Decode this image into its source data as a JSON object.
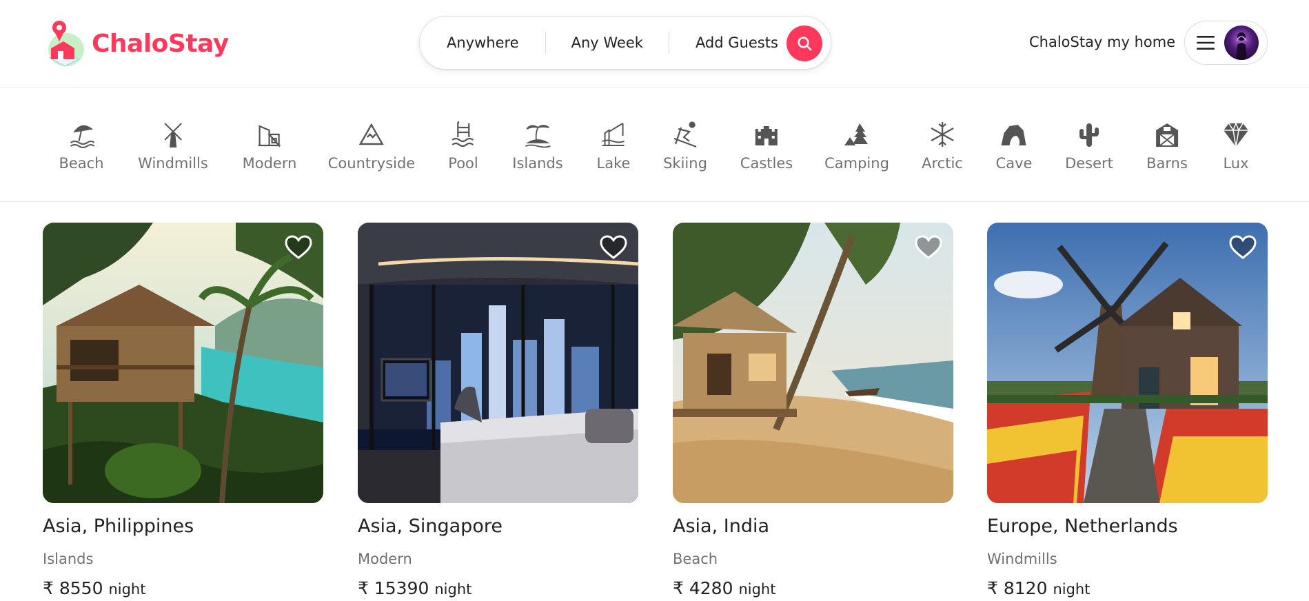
{
  "brand": {
    "name": "ChaloStay",
    "accent": "#ff385c"
  },
  "search": {
    "where": "Anywhere",
    "when": "Any Week",
    "guests": "Add Guests"
  },
  "header": {
    "host_link": "ChaloStay my home"
  },
  "categories": [
    {
      "label": "Beach",
      "icon": "beach-umbrella-icon"
    },
    {
      "label": "Windmills",
      "icon": "windmill-icon"
    },
    {
      "label": "Modern",
      "icon": "modern-building-icon"
    },
    {
      "label": "Countryside",
      "icon": "mountain-icon"
    },
    {
      "label": "Pool",
      "icon": "pool-ladder-icon"
    },
    {
      "label": "Islands",
      "icon": "palm-island-icon"
    },
    {
      "label": "Lake",
      "icon": "fishing-lake-icon"
    },
    {
      "label": "Skiing",
      "icon": "skier-icon"
    },
    {
      "label": "Castles",
      "icon": "castle-icon"
    },
    {
      "label": "Camping",
      "icon": "tent-icon"
    },
    {
      "label": "Arctic",
      "icon": "snowflake-icon"
    },
    {
      "label": "Cave",
      "icon": "cave-icon"
    },
    {
      "label": "Desert",
      "icon": "cactus-icon"
    },
    {
      "label": "Barns",
      "icon": "barn-icon"
    },
    {
      "label": "Lux",
      "icon": "diamond-icon"
    }
  ],
  "listings": [
    {
      "location": "Asia, Philippines",
      "category": "Islands",
      "price": "₹ 8550",
      "unit": "night"
    },
    {
      "location": "Asia, Singapore",
      "category": "Modern",
      "price": "₹ 15390",
      "unit": "night"
    },
    {
      "location": "Asia, India",
      "category": "Beach",
      "price": "₹ 4280",
      "unit": "night"
    },
    {
      "location": "Europe, Netherlands",
      "category": "Windmills",
      "price": "₹ 8120",
      "unit": "night"
    }
  ]
}
